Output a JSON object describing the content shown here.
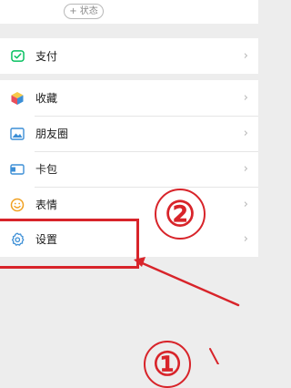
{
  "profile": {
    "status_button_label": "+ 状态"
  },
  "groups": [
    {
      "items": [
        {
          "label": "支付",
          "icon": "wechat-pay-icon",
          "chevron": "›"
        }
      ]
    },
    {
      "items": [
        {
          "label": "收藏",
          "icon": "favorites-cube-icon",
          "chevron": "›"
        },
        {
          "label": "朋友圈",
          "icon": "moments-image-icon",
          "chevron": "›"
        },
        {
          "label": "卡包",
          "icon": "card-wallet-icon",
          "chevron": "›"
        },
        {
          "label": "表情",
          "icon": "emoji-smile-icon",
          "chevron": "›"
        }
      ]
    },
    {
      "items": [
        {
          "label": "设置",
          "icon": "settings-gear-icon",
          "chevron": "›"
        }
      ]
    }
  ],
  "annotations": {
    "marker_2": "②",
    "marker_1": "①",
    "accent_color": "#d8242a"
  },
  "colors": {
    "background": "#ededed",
    "row_background": "#ffffff",
    "wechat_green": "#07c160",
    "icon_blue": "#3d8fd6",
    "icon_orange": "#f0a020"
  }
}
